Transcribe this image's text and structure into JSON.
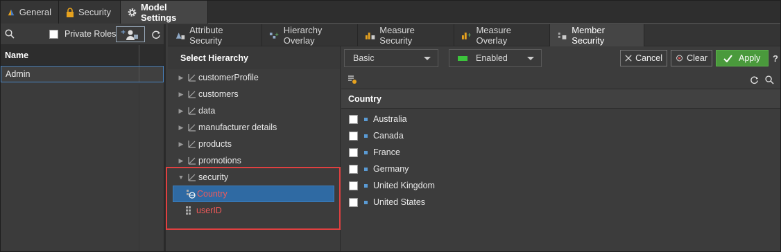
{
  "top_tabs": [
    {
      "label": "General",
      "icon": "pyramid-icon"
    },
    {
      "label": "Security",
      "icon": "lock-icon"
    },
    {
      "label": "Model Settings",
      "icon": "gear-icon",
      "active": true
    }
  ],
  "left_panel": {
    "private_roles_label": "Private Roles",
    "column_header": "Name",
    "rows": [
      "Admin"
    ]
  },
  "sub_tabs": [
    {
      "label": "Attribute Security",
      "icon": "attribute-security-icon"
    },
    {
      "label": "Hierarchy Overlay",
      "icon": "hierarchy-overlay-icon"
    },
    {
      "label": "Measure Security",
      "icon": "measure-security-icon"
    },
    {
      "label": "Measure Overlay",
      "icon": "measure-overlay-icon"
    },
    {
      "label": "Member Security",
      "icon": "member-security-icon",
      "active": true
    }
  ],
  "hierarchy": {
    "title": "Select Hierarchy",
    "items": [
      "customerProfile",
      "customers",
      "data",
      "manufacturer details",
      "products",
      "promotions",
      "security"
    ],
    "children": [
      {
        "label": "Country",
        "selected": true
      },
      {
        "label": "userID",
        "selected": false
      }
    ]
  },
  "toolbar": {
    "mode_value": "Basic",
    "status_value": "Enabled",
    "cancel_label": "Cancel",
    "clear_label": "Clear",
    "apply_label": "Apply",
    "help_label": "?"
  },
  "members": {
    "header": "Country",
    "items": [
      "Australia",
      "Canada",
      "France",
      "Germany",
      "United Kingdom",
      "United States"
    ]
  },
  "colors": {
    "accent_blue": "#2f6aa3",
    "apply_green": "#4a9a3c",
    "highlight_red": "#e04040",
    "enabled_green": "#3cc43c"
  }
}
